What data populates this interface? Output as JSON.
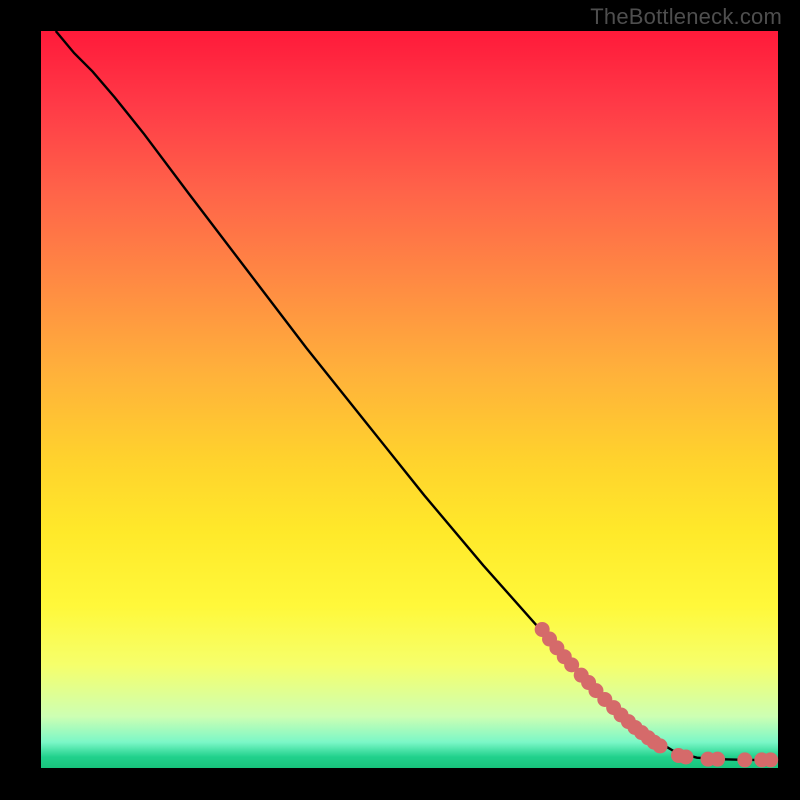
{
  "watermark": "TheBottleneck.com",
  "colors": {
    "frame_bg": "#000000",
    "curve": "#000000",
    "marker": "#d56a6a",
    "watermark": "#4e4e4e"
  },
  "chart_data": {
    "type": "line",
    "title": "",
    "xlabel": "",
    "ylabel": "",
    "xlim": [
      0,
      100
    ],
    "ylim": [
      0,
      100
    ],
    "grid": false,
    "legend": false,
    "curve_points": [
      {
        "x": 2.0,
        "y": 100.0
      },
      {
        "x": 4.5,
        "y": 97.0
      },
      {
        "x": 7.0,
        "y": 94.5
      },
      {
        "x": 10.0,
        "y": 91.0
      },
      {
        "x": 14.0,
        "y": 86.0
      },
      {
        "x": 20.0,
        "y": 78.0
      },
      {
        "x": 28.0,
        "y": 67.5
      },
      {
        "x": 36.0,
        "y": 57.0
      },
      {
        "x": 44.0,
        "y": 47.0
      },
      {
        "x": 52.0,
        "y": 37.0
      },
      {
        "x": 60.0,
        "y": 27.5
      },
      {
        "x": 68.0,
        "y": 18.5
      },
      {
        "x": 74.0,
        "y": 12.0
      },
      {
        "x": 79.0,
        "y": 7.0
      },
      {
        "x": 83.0,
        "y": 4.0
      },
      {
        "x": 86.0,
        "y": 2.2
      },
      {
        "x": 89.0,
        "y": 1.4
      },
      {
        "x": 92.0,
        "y": 1.2
      },
      {
        "x": 96.0,
        "y": 1.1
      },
      {
        "x": 100.0,
        "y": 1.1
      }
    ],
    "markers": [
      {
        "x": 68.0,
        "y": 18.8
      },
      {
        "x": 69.0,
        "y": 17.5
      },
      {
        "x": 70.0,
        "y": 16.3
      },
      {
        "x": 71.0,
        "y": 15.1
      },
      {
        "x": 72.0,
        "y": 14.0
      },
      {
        "x": 73.3,
        "y": 12.6
      },
      {
        "x": 74.3,
        "y": 11.6
      },
      {
        "x": 75.3,
        "y": 10.5
      },
      {
        "x": 76.5,
        "y": 9.3
      },
      {
        "x": 77.7,
        "y": 8.2
      },
      {
        "x": 78.7,
        "y": 7.2
      },
      {
        "x": 79.7,
        "y": 6.3
      },
      {
        "x": 80.6,
        "y": 5.5
      },
      {
        "x": 81.5,
        "y": 4.8
      },
      {
        "x": 82.4,
        "y": 4.1
      },
      {
        "x": 83.2,
        "y": 3.5
      },
      {
        "x": 84.0,
        "y": 3.0
      },
      {
        "x": 86.5,
        "y": 1.7
      },
      {
        "x": 87.5,
        "y": 1.5
      },
      {
        "x": 90.5,
        "y": 1.2
      },
      {
        "x": 91.8,
        "y": 1.2
      },
      {
        "x": 95.5,
        "y": 1.1
      },
      {
        "x": 97.8,
        "y": 1.1
      },
      {
        "x": 99.0,
        "y": 1.1
      }
    ]
  }
}
